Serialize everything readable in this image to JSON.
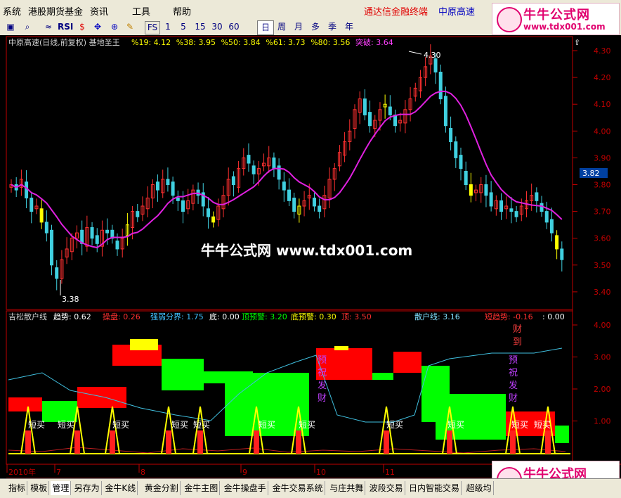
{
  "menu": {
    "items": [
      "系统",
      "港股期货基金",
      "资讯",
      "工具",
      "帮助"
    ],
    "right1": "通达信金融终端",
    "right2": "中原高速"
  },
  "toolbar": {
    "rsi": "RSI",
    "fs": "FS",
    "minutes": [
      "1",
      "5",
      "15",
      "30",
      "60"
    ],
    "periods": [
      "日",
      "周",
      "月",
      "多",
      "季",
      "年"
    ],
    "active_period": "日"
  },
  "logo": {
    "title": "牛牛公式网",
    "url": "www.tdx001.com"
  },
  "watermark": "牛牛公式网 www.tdx001.com",
  "main_header": {
    "name": "中原高速(日线,前复权) 基地圣王",
    "fields": [
      {
        "label": "%19: 4.12",
        "color": "#ffff00"
      },
      {
        "label": "%38: 3.95",
        "color": "#ffff00"
      },
      {
        "label": "%50: 3.84",
        "color": "#ffff00"
      },
      {
        "label": "%61: 3.73",
        "color": "#ffff00"
      },
      {
        "label": "%80: 3.56",
        "color": "#ffff00"
      },
      {
        "label": "突破: 3.64",
        "color": "#ff40ff"
      }
    ]
  },
  "main_axis": {
    "ticks": [
      "4.30",
      "4.20",
      "4.10",
      "4.00",
      "3.90",
      "3.80",
      "3.70",
      "3.60",
      "3.50",
      "3.40"
    ],
    "current": "3.82"
  },
  "annotations": {
    "high": "4.30",
    "low": "3.38"
  },
  "sub_header": {
    "name": "吉松散户线",
    "fields": [
      {
        "label": "趋势: 0.62",
        "color": "#ffffff"
      },
      {
        "label": "操盘: 0.26",
        "color": "#ff3030"
      },
      {
        "label": "强弱分界: 1.75",
        "color": "#40c0ff"
      },
      {
        "label": "底: 0.00",
        "color": "#ffffff"
      },
      {
        "label": "顶预警: 3.20",
        "color": "#00ff00"
      },
      {
        "label": "底预警: 0.30",
        "color": "#ffff00"
      },
      {
        "label": "顶: 3.50",
        "color": "#ff3030"
      },
      {
        "label": "散户线: 3.16",
        "color": "#80e0ff"
      },
      {
        "label": "短趋势: -0.16",
        "color": "#ff3030"
      },
      {
        "label": ": 0.00",
        "color": "#ffffff"
      }
    ]
  },
  "sub_axis": {
    "ticks": [
      "4.00",
      "3.00",
      "2.00",
      "1.00"
    ]
  },
  "sub_labels": {
    "buy": "短买",
    "warn": "预祝发财",
    "fortune": "财到"
  },
  "date_axis": {
    "labels": [
      "2010年",
      "7",
      "8",
      "9",
      "10",
      "11"
    ]
  },
  "bottom_tabs": [
    "指标",
    "模板",
    "管理",
    "另存为",
    "金牛K线",
    "黄金分割",
    "金牛主图",
    "金牛操盘手",
    "金牛交易系统",
    "与庄共舞",
    "波段交易",
    "日内智能交易",
    "超级均"
  ],
  "active_tab": "管理",
  "colors": {
    "up": "#ff3030",
    "down": "#40d0e0",
    "ma": "#e020e0",
    "axis": "#c00000",
    "buy_bar": "#ff2020",
    "green_band": "#00ff00",
    "red_band": "#ff0000"
  }
}
